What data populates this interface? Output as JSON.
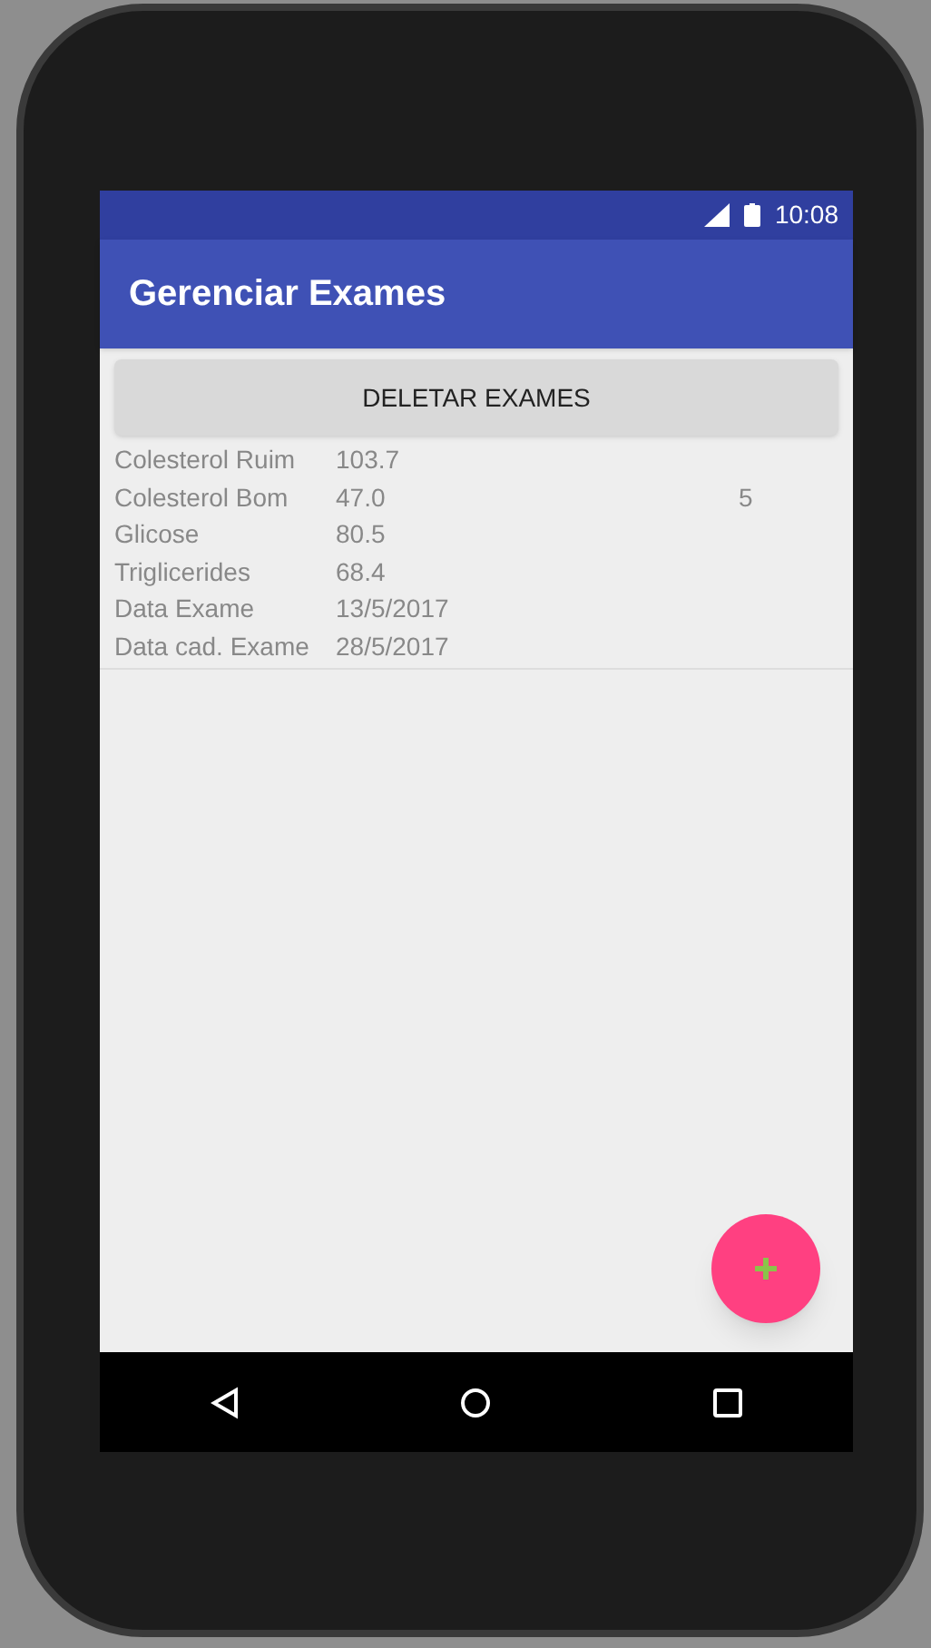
{
  "status_bar": {
    "time": "10:08"
  },
  "app_bar": {
    "title": "Gerenciar Exames"
  },
  "delete_button": {
    "label": "DELETAR EXAMES"
  },
  "exams": [
    {
      "column_3": "5",
      "fields": [
        {
          "label": "Colesterol Ruim",
          "value": "103.7"
        },
        {
          "label": "Colesterol Bom",
          "value": "47.0"
        },
        {
          "label": "Glicose",
          "value": "80.5"
        },
        {
          "label": "Triglicerides",
          "value": "68.4"
        },
        {
          "label": "Data Exame",
          "value": "13/5/2017"
        },
        {
          "label": "Data cad. Exame",
          "value": "28/5/2017"
        }
      ]
    }
  ]
}
